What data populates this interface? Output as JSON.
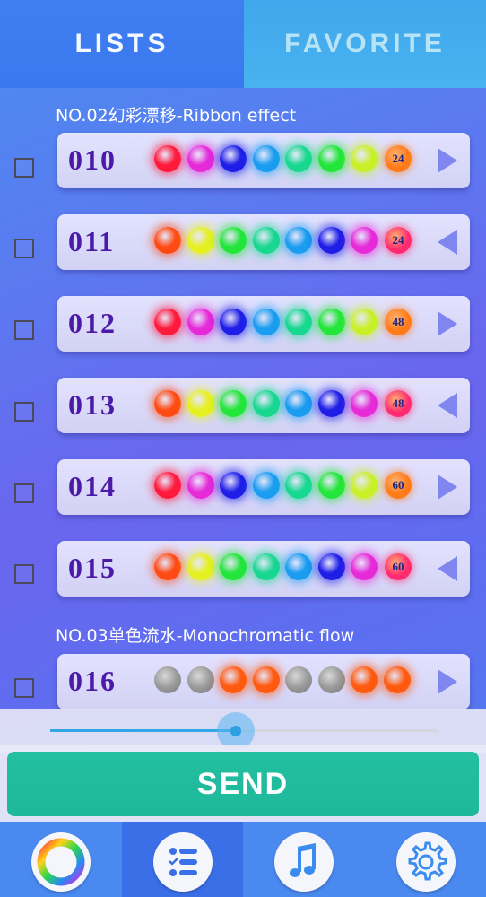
{
  "tabs": {
    "lists": "LISTS",
    "favorite": "FAVORITE"
  },
  "sections": [
    {
      "label": "NO.02幻彩漂移-Ribbon effect"
    },
    {
      "label": "NO.03单色流水-Monochromatic flow"
    }
  ],
  "rows": [
    {
      "num": "010",
      "speed": "24",
      "direction": "right",
      "dots": [
        "#ff1a3c",
        "#e62ad8",
        "#1e1ee6",
        "#1a9cf0",
        "#18d890",
        "#22e63a",
        "#c8f028"
      ],
      "speed_color": "#ff7a18"
    },
    {
      "num": "011",
      "speed": "24",
      "direction": "left",
      "dots": [
        "#ff4a14",
        "#e6f020",
        "#22e63a",
        "#18d890",
        "#1a9cf0",
        "#1e1ee6",
        "#e62ad8"
      ],
      "speed_color": "#ff2a70"
    },
    {
      "num": "012",
      "speed": "48",
      "direction": "right",
      "dots": [
        "#ff1a3c",
        "#e62ad8",
        "#1e1ee6",
        "#1a9cf0",
        "#18d890",
        "#22e63a",
        "#c8f028"
      ],
      "speed_color": "#ff7a18"
    },
    {
      "num": "013",
      "speed": "48",
      "direction": "left",
      "dots": [
        "#ff4a14",
        "#e6f020",
        "#22e63a",
        "#18d890",
        "#1a9cf0",
        "#1e1ee6",
        "#e62ad8"
      ],
      "speed_color": "#ff2a70"
    },
    {
      "num": "014",
      "speed": "60",
      "direction": "right",
      "dots": [
        "#ff1a3c",
        "#e62ad8",
        "#1e1ee6",
        "#1a9cf0",
        "#18d890",
        "#22e63a",
        "#c8f028"
      ],
      "speed_color": "#ff7a18"
    },
    {
      "num": "015",
      "speed": "60",
      "direction": "left",
      "dots": [
        "#ff4a14",
        "#e6f020",
        "#22e63a",
        "#18d890",
        "#1a9cf0",
        "#1e1ee6",
        "#e62ad8"
      ],
      "speed_color": "#ff2a70"
    },
    {
      "num": "016",
      "speed": "",
      "direction": "right",
      "dots": [
        "#9a9a9a",
        "#9a9a9a",
        "#ff5a10",
        "#ff5a10",
        "#9a9a9a",
        "#9a9a9a",
        "#ff5a10",
        "#ff5a10"
      ],
      "speed_color": ""
    }
  ],
  "slider": {
    "value_fraction": 0.48
  },
  "send_label": "SEND",
  "nav": [
    {
      "icon": "color-wheel-icon",
      "active": false
    },
    {
      "icon": "list-icon",
      "active": true
    },
    {
      "icon": "music-note-icon",
      "active": false
    },
    {
      "icon": "settings-gear-icon",
      "active": false
    }
  ],
  "colors": {
    "accent": "#22c0a0",
    "number": "#4b1aa8",
    "arrow": "#7f86f0"
  }
}
